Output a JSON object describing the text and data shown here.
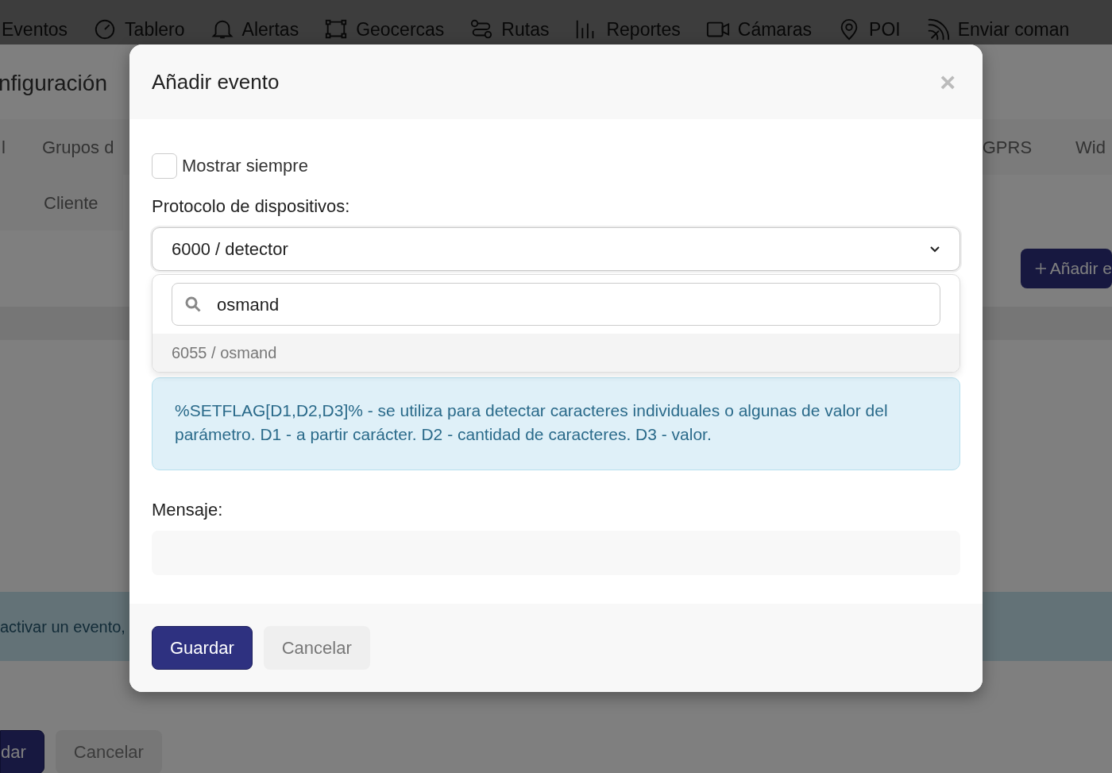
{
  "nav": {
    "items": [
      {
        "label": "Eventos",
        "kind": "none"
      },
      {
        "label": "Tablero",
        "kind": "gauge"
      },
      {
        "label": "Alertas",
        "kind": "bell"
      },
      {
        "label": "Geocercas",
        "kind": "polygon"
      },
      {
        "label": "Rutas",
        "kind": "route"
      },
      {
        "label": "Reportes",
        "kind": "bars"
      },
      {
        "label": "Cámaras",
        "kind": "camera"
      },
      {
        "label": "POI",
        "kind": "pin"
      },
      {
        "label": "Enviar coman",
        "kind": "signal"
      }
    ]
  },
  "page": {
    "title": "nfiguración",
    "tabs_left": [
      "l",
      "Grupos d"
    ],
    "tabs_right": [
      "GPRS",
      "Wid"
    ],
    "tabs_second_row": [
      "Cliente"
    ],
    "add_button": "Añadir e",
    "alert": "activar un evento,",
    "buttons": [
      {
        "label": "dar",
        "kind": "primary"
      },
      {
        "label": "Cancelar",
        "kind": "secondary"
      }
    ]
  },
  "modal": {
    "title": "Añadir evento",
    "close": "×",
    "show_always": {
      "label": "Mostrar siempre",
      "checked": false
    },
    "protocol": {
      "label": "Protocolo de dispositivos:",
      "value": "6000 / detector",
      "expanded": true,
      "search": "osmand",
      "options": [
        {
          "label": "6055 / osmand",
          "highlighted": true
        }
      ]
    },
    "info": "%SETFLAG[D1,D2,D3]% - se utiliza para detectar caracteres individuales o algunas de valor del parámetro. D1 - a partir carácter. D2 - cantidad de caracteres. D3 - valor.",
    "message": {
      "label": "Mensaje:"
    },
    "buttons": [
      {
        "label": "Guardar",
        "kind": "primary"
      },
      {
        "label": "Cancelar",
        "kind": "secondary"
      }
    ]
  }
}
